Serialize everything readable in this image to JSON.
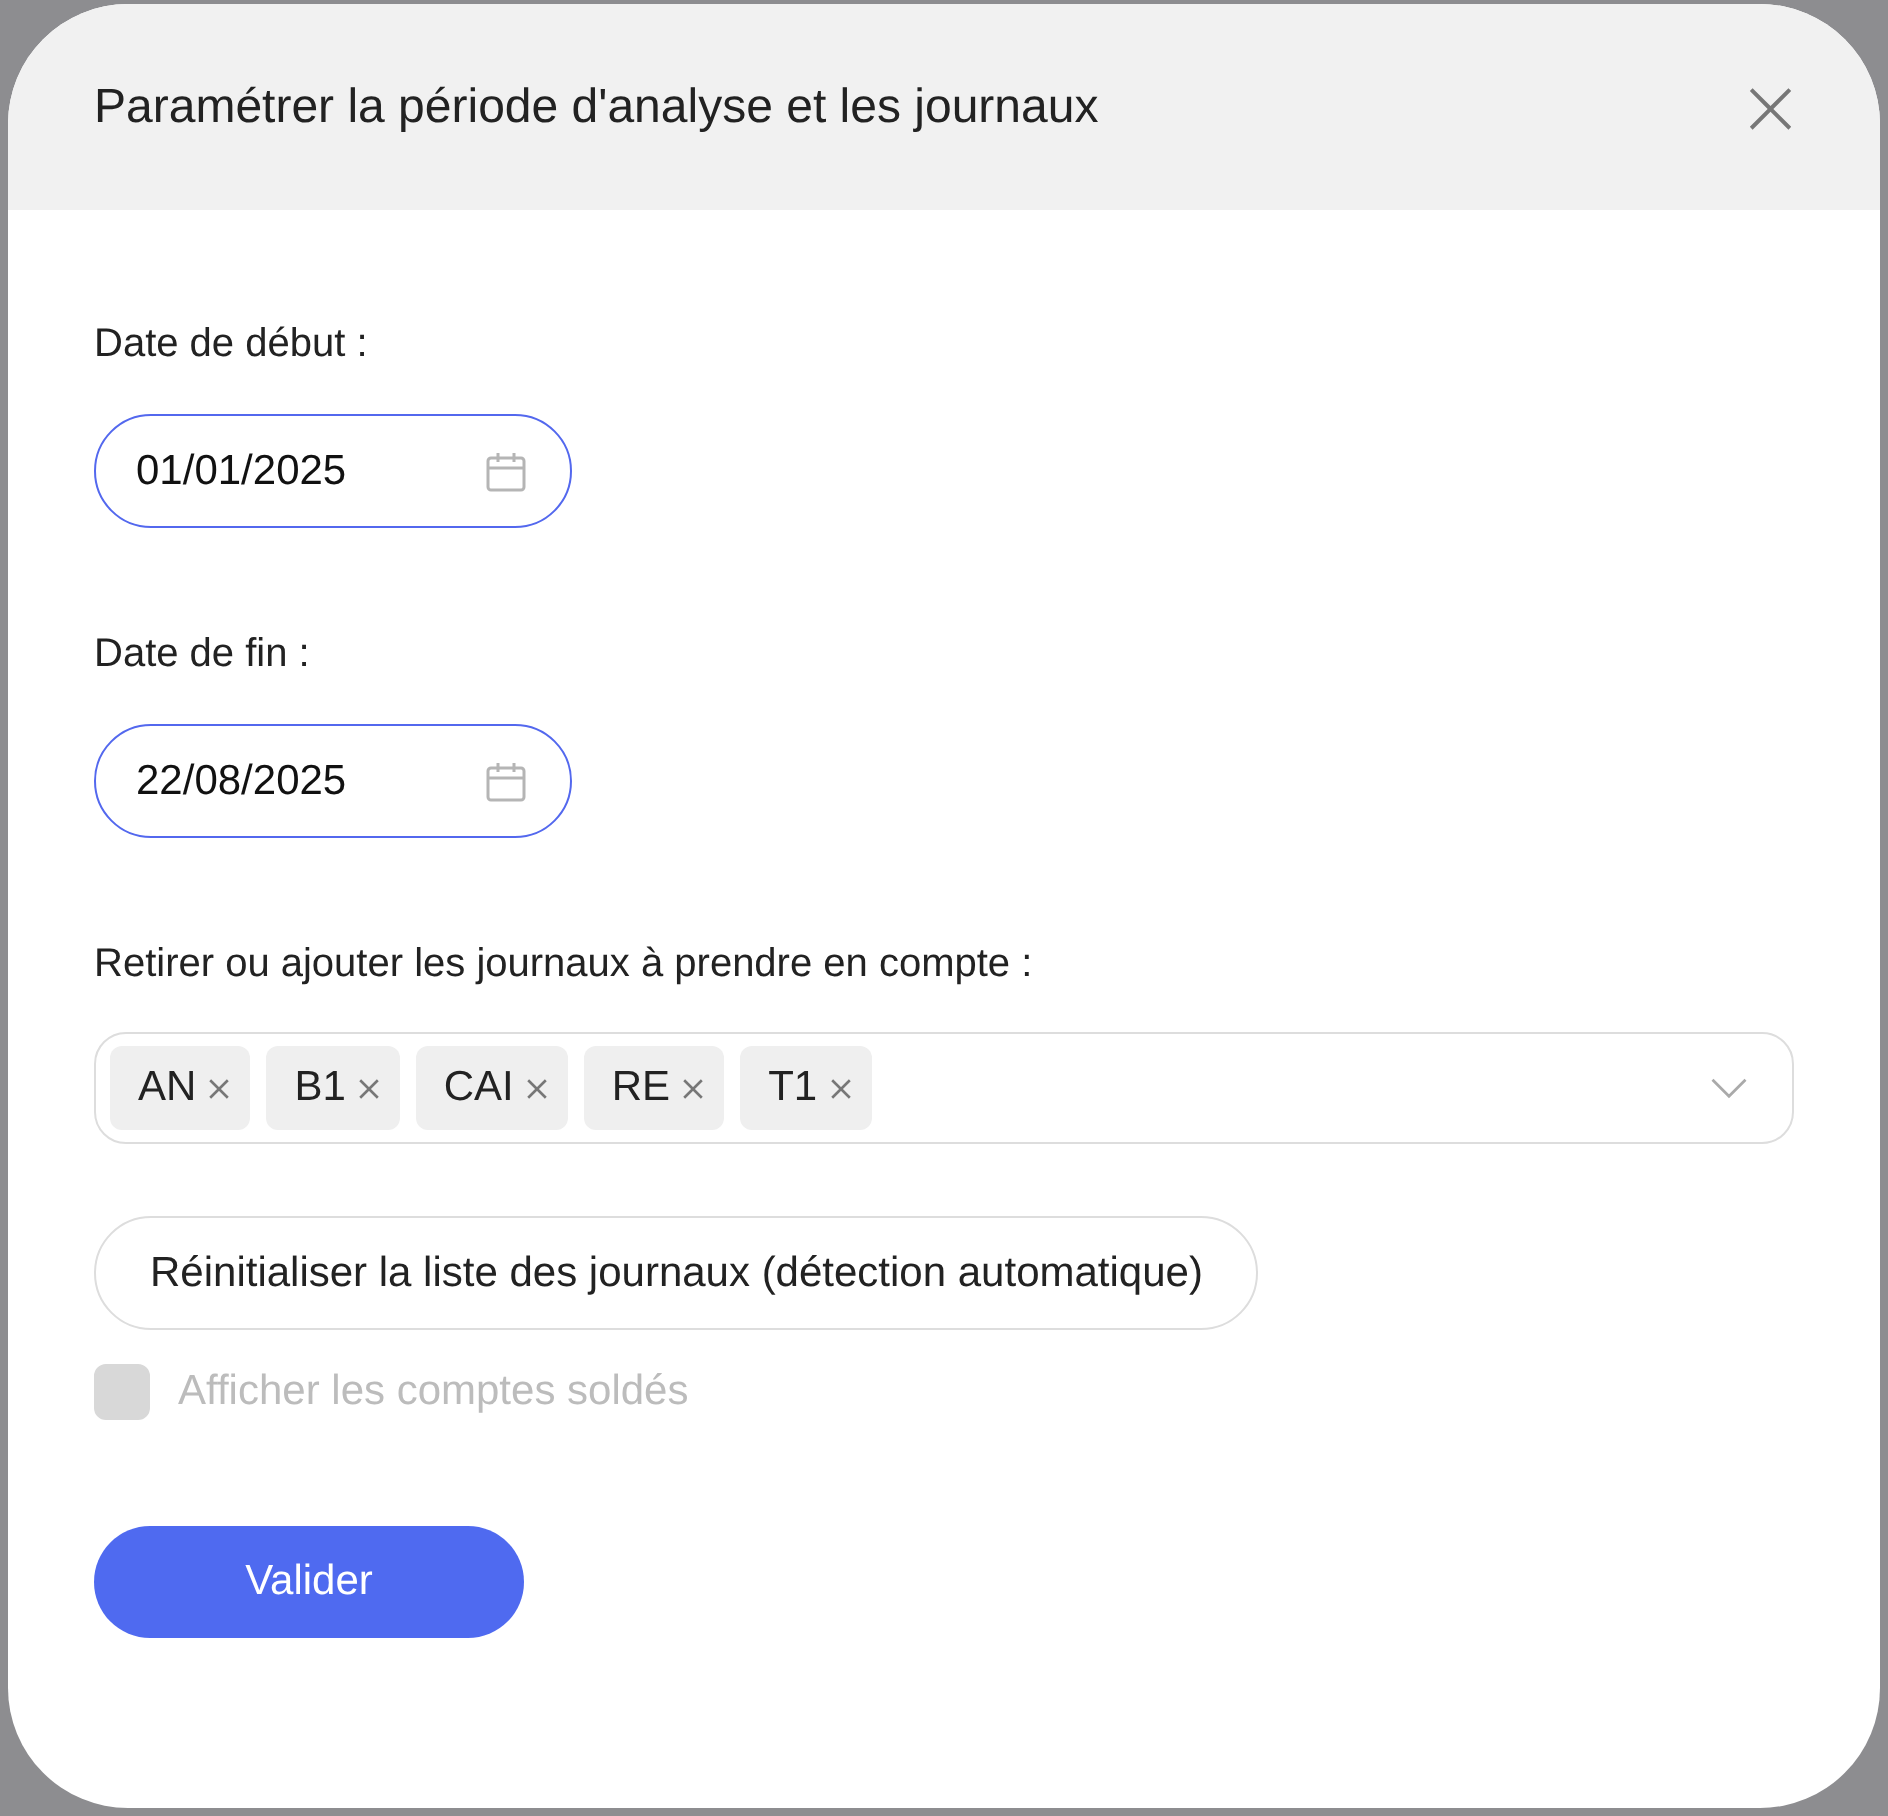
{
  "dialog": {
    "title": "Paramétrer la période d'analyse et les journaux",
    "close": "×"
  },
  "fields": [
    {
      "label": "Date de début :",
      "value": "01/01/2025",
      "focused": true
    },
    {
      "label": "Date de fin :",
      "value": "22/08/2025",
      "focused": true
    }
  ],
  "journals": {
    "label": "Retirer ou ajouter les journaux à prendre en compte :",
    "tags": [
      {
        "label": "AN"
      },
      {
        "label": "B1"
      },
      {
        "label": "CAI"
      },
      {
        "label": "RE"
      },
      {
        "label": "T1"
      }
    ]
  },
  "reset_button": "Réinitialiser la liste des journaux (détection automatique)",
  "checkbox": {
    "label": "Afficher les comptes soldés",
    "checked": false,
    "disabled": true
  },
  "submit_button": "Valider"
}
